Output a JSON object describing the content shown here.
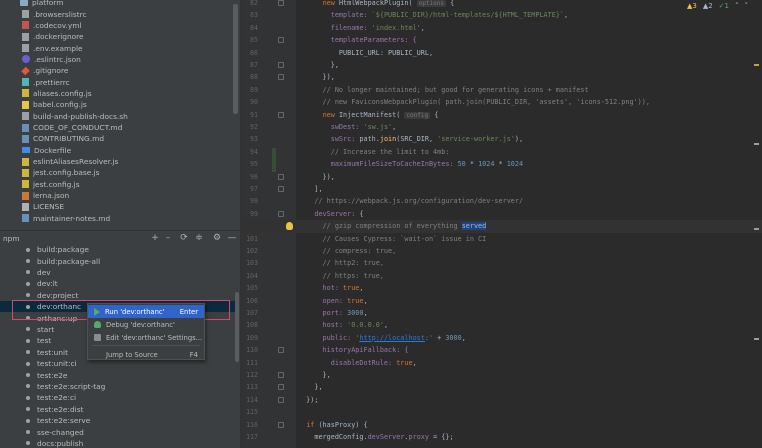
{
  "project_files": [
    {
      "name": "platform",
      "icon": "folder-icon",
      "kind": "folder"
    },
    {
      "name": ".browserslistrc",
      "icon": "file-icon",
      "kind": "file"
    },
    {
      "name": ".codecov.yml",
      "icon": "yml-icon",
      "kind": "yml"
    },
    {
      "name": ".dockerignore",
      "icon": "docker-icon",
      "kind": "file"
    },
    {
      "name": ".env.example",
      "icon": "file-icon",
      "kind": "file"
    },
    {
      "name": ".eslintrc.json",
      "icon": "eslint-icon",
      "kind": "eslint"
    },
    {
      "name": ".gitignore",
      "icon": "git-icon",
      "kind": "git"
    },
    {
      "name": ".prettierrc",
      "icon": "prettier-icon",
      "kind": "prettier"
    },
    {
      "name": "aliases.config.js",
      "icon": "js-icon",
      "kind": "js"
    },
    {
      "name": "babel.config.js",
      "icon": "babel-icon",
      "kind": "babel"
    },
    {
      "name": "build-and-publish-docs.sh",
      "icon": "file-icon",
      "kind": "file"
    },
    {
      "name": "CODE_OF_CONDUCT.md",
      "icon": "markdown-icon",
      "kind": "md"
    },
    {
      "name": "CONTRIBUTING.md",
      "icon": "markdown-icon",
      "kind": "md"
    },
    {
      "name": "Dockerfile",
      "icon": "docker-icon",
      "kind": "docker"
    },
    {
      "name": "eslintAliasesResolver.js",
      "icon": "js-icon",
      "kind": "js"
    },
    {
      "name": "jest.config.base.js",
      "icon": "js-icon",
      "kind": "js"
    },
    {
      "name": "jest.config.js",
      "icon": "js-icon",
      "kind": "js"
    },
    {
      "name": "lerna.json",
      "icon": "json-icon",
      "kind": "json"
    },
    {
      "name": "LICENSE",
      "icon": "license-icon",
      "kind": "lic"
    },
    {
      "name": "maintainer-notes.md",
      "icon": "markdown-icon",
      "kind": "md"
    }
  ],
  "npm": {
    "title": "npm",
    "scripts": [
      "build:package",
      "build:package-all",
      "dev",
      "dev:lt",
      "dev:project",
      "dev:orthanc",
      "orthanc:up",
      "start",
      "test",
      "test:unit",
      "test:unit:ci",
      "test:e2e",
      "test:e2e:script-tag",
      "test:e2e:ci",
      "test:e2e:dist",
      "test:e2e:serve",
      "sse-changed",
      "docs:publish"
    ],
    "selected_index": 5
  },
  "context_menu": {
    "items": [
      {
        "label": "Run 'dev:orthanc'",
        "shortcut": "Enter",
        "icon": "run-icon"
      },
      {
        "label": "Debug 'dev:orthanc'",
        "shortcut": "",
        "icon": "debug-icon"
      },
      {
        "label": "Edit 'dev:orthanc' Settings...",
        "shortcut": "",
        "icon": "edit-icon"
      },
      {
        "label": "Jump to Source",
        "shortcut": "F4",
        "icon": ""
      }
    ],
    "active_index": 0
  },
  "editor": {
    "inspections": {
      "warnings": "▲3",
      "weak": "▲2",
      "typos": "✓1"
    },
    "current_line": "100",
    "lines": [
      {
        "n": "82",
        "parts": [
          [
            "      ",
            ""
          ],
          [
            "new ",
            "kw"
          ],
          [
            "HtmlWebpackPlugin",
            ""
          ],
          [
            "( ",
            ""
          ],
          [
            "options",
            "hint"
          ],
          [
            " {",
            ""
          ]
        ]
      },
      {
        "n": "83",
        "parts": [
          [
            "        template: ",
            "prop"
          ],
          [
            "`${PUBLIC_DIR}/html-templates/${HTML_TEMPLATE}`",
            "str"
          ],
          [
            ",",
            ""
          ]
        ]
      },
      {
        "n": "84",
        "parts": [
          [
            "        filename: ",
            "prop"
          ],
          [
            "'index.html'",
            "str"
          ],
          [
            ",",
            ""
          ]
        ]
      },
      {
        "n": "85",
        "parts": [
          [
            "        templateParameters: {",
            "prop"
          ]
        ]
      },
      {
        "n": "86",
        "parts": [
          [
            "          PUBLIC_URL: PUBLIC_URL,",
            ""
          ]
        ]
      },
      {
        "n": "87",
        "parts": [
          [
            "        },",
            ""
          ]
        ]
      },
      {
        "n": "88",
        "parts": [
          [
            "      }),",
            ""
          ]
        ]
      },
      {
        "n": "89",
        "parts": [
          [
            "      // No longer maintained; but good for generating icons + manifest",
            "cmt"
          ]
        ]
      },
      {
        "n": "90",
        "parts": [
          [
            "      // new FaviconsWebpackPlugin( path.join(PUBLIC_DIR, 'assets', 'icons-512.png')),",
            "cmt"
          ]
        ]
      },
      {
        "n": "91",
        "parts": [
          [
            "      ",
            ""
          ],
          [
            "new ",
            "kw"
          ],
          [
            "InjectManifest( ",
            ""
          ],
          [
            "config",
            "hint"
          ],
          [
            " {",
            ""
          ]
        ]
      },
      {
        "n": "92",
        "parts": [
          [
            "        swDest: ",
            "prop"
          ],
          [
            "'sw.js'",
            "str"
          ],
          [
            ",",
            ""
          ]
        ]
      },
      {
        "n": "93",
        "parts": [
          [
            "        swSrc: ",
            "prop"
          ],
          [
            "path.",
            ""
          ],
          [
            "join",
            "fn"
          ],
          [
            "(SRC_DIR, ",
            ""
          ],
          [
            "'service-worker.js'",
            "str"
          ],
          [
            "),",
            ""
          ]
        ]
      },
      {
        "n": "94",
        "parts": [
          [
            "        // Increase the limit to 4mb:",
            "cmt"
          ]
        ]
      },
      {
        "n": "95",
        "parts": [
          [
            "        maximumFileSizeToCacheInBytes: ",
            "prop"
          ],
          [
            "50",
            "num"
          ],
          [
            " * ",
            ""
          ],
          [
            "1024",
            "num"
          ],
          [
            " * ",
            ""
          ],
          [
            "1024",
            "num"
          ]
        ]
      },
      {
        "n": "96",
        "parts": [
          [
            "      }),",
            ""
          ]
        ]
      },
      {
        "n": "97",
        "parts": [
          [
            "    ],",
            ""
          ]
        ]
      },
      {
        "n": "98",
        "parts": [
          [
            "    // https://webpack.js.org/configuration/dev-server/",
            "cmt"
          ]
        ]
      },
      {
        "n": "99",
        "parts": [
          [
            "    devServer: ",
            "prop"
          ],
          [
            "{",
            ""
          ]
        ]
      },
      {
        "n": "100",
        "parts": [
          [
            "      // gzip compression of everything ",
            "cmt"
          ],
          [
            "served",
            "selword"
          ]
        ]
      },
      {
        "n": "101",
        "parts": [
          [
            "      // Causes Cypress: `wait-on` issue in CI",
            "cmt"
          ]
        ]
      },
      {
        "n": "102",
        "parts": [
          [
            "      // compress: true,",
            "cmt"
          ]
        ]
      },
      {
        "n": "103",
        "parts": [
          [
            "      // http2: true,",
            "cmt"
          ]
        ]
      },
      {
        "n": "104",
        "parts": [
          [
            "      // https: true,",
            "cmt"
          ]
        ]
      },
      {
        "n": "105",
        "parts": [
          [
            "      hot: ",
            "prop"
          ],
          [
            "true",
            "kw"
          ],
          [
            ",",
            ""
          ]
        ]
      },
      {
        "n": "106",
        "parts": [
          [
            "      open: ",
            "prop"
          ],
          [
            "true",
            "kw"
          ],
          [
            ",",
            ""
          ]
        ]
      },
      {
        "n": "107",
        "parts": [
          [
            "      port: ",
            "prop"
          ],
          [
            "3000",
            "num"
          ],
          [
            ",",
            ""
          ]
        ]
      },
      {
        "n": "108",
        "parts": [
          [
            "      host: ",
            "prop"
          ],
          [
            "'0.0.0.0'",
            "str"
          ],
          [
            ",",
            ""
          ]
        ]
      },
      {
        "n": "109",
        "parts": [
          [
            "      public: ",
            "prop"
          ],
          [
            "'",
            "str"
          ],
          [
            "http://localhost",
            "link"
          ],
          [
            ":'",
            "str"
          ],
          [
            " + ",
            ""
          ],
          [
            "3000",
            "num"
          ],
          [
            ",",
            ""
          ]
        ]
      },
      {
        "n": "110",
        "parts": [
          [
            "      historyApiFallback: {",
            "prop"
          ]
        ]
      },
      {
        "n": "111",
        "parts": [
          [
            "        disableDotRule: ",
            "prop"
          ],
          [
            "true",
            "kw"
          ],
          [
            ",",
            ""
          ]
        ]
      },
      {
        "n": "112",
        "parts": [
          [
            "      },",
            ""
          ]
        ]
      },
      {
        "n": "113",
        "parts": [
          [
            "    },",
            ""
          ]
        ]
      },
      {
        "n": "114",
        "parts": [
          [
            "  });",
            ""
          ]
        ]
      },
      {
        "n": "115",
        "parts": [
          [
            "",
            ""
          ]
        ]
      },
      {
        "n": "116",
        "parts": [
          [
            "  ",
            ""
          ],
          [
            "if ",
            "kw"
          ],
          [
            "(hasProxy) {",
            ""
          ]
        ]
      },
      {
        "n": "117",
        "parts": [
          [
            "    mergedConfig.",
            ""
          ],
          [
            "devServer",
            "prop"
          ],
          [
            ".",
            ""
          ],
          [
            "proxy",
            "prop"
          ],
          [
            " = {};",
            ""
          ]
        ]
      }
    ]
  },
  "colors": {
    "selection": "#0d293e",
    "menu_active": "#2f65ca",
    "highlight_border": "#d04a6c"
  }
}
